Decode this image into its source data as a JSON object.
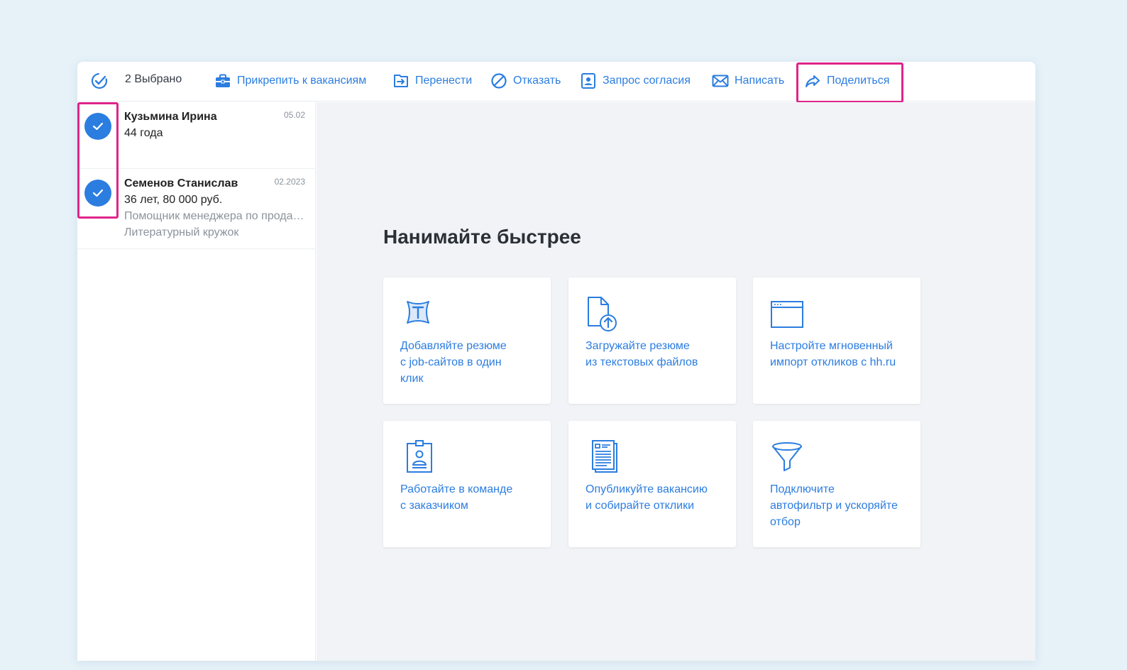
{
  "toolbar": {
    "selected_count": "2 Выбрано",
    "actions": [
      {
        "label": "Прикрепить к вакансиям",
        "icon": "briefcase-icon"
      },
      {
        "label": "Перенести",
        "icon": "move-icon"
      },
      {
        "label": "Отказать",
        "icon": "block-icon"
      },
      {
        "label": "Запрос согласия",
        "icon": "consent-icon"
      },
      {
        "label": "Написать",
        "icon": "mail-icon"
      },
      {
        "label": "Поделиться",
        "icon": "share-icon"
      }
    ]
  },
  "candidates": [
    {
      "name": "Кузьмина Ирина",
      "date": "05.02",
      "details": "44 года",
      "selected": true
    },
    {
      "name": "Семенов Станислав",
      "date": "02.2023",
      "details": "36 лет, 80 000 руб.",
      "position": "Помощник менеджера по продажам",
      "note": "Литературный кружок",
      "selected": true
    }
  ],
  "main": {
    "headline": "Нанимайте быстрее",
    "cards": [
      {
        "text": "Добавляйте резюме\nс job-сайтов в один\nклик",
        "icon": "plugin-t-icon"
      },
      {
        "text": "Загружайте резюме\nиз текстовых файлов",
        "icon": "file-upload-icon"
      },
      {
        "text": "Настройте мгновенный\nимпорт откликов с hh.ru",
        "icon": "browser-window-icon"
      },
      {
        "text": "Работайте в команде\nс заказчиком",
        "icon": "badge-icon"
      },
      {
        "text": "Опубликуйте вакансию\nи собирайте отклики",
        "icon": "document-icon"
      },
      {
        "text": "Подключите\nавтофильтр и ускоряйте\nотбор",
        "icon": "funnel-icon"
      }
    ]
  },
  "colors": {
    "accent": "#2b7de0",
    "highlight": "#e0248a",
    "background": "#e6f1f8",
    "main_bg": "#f1f3f6"
  }
}
